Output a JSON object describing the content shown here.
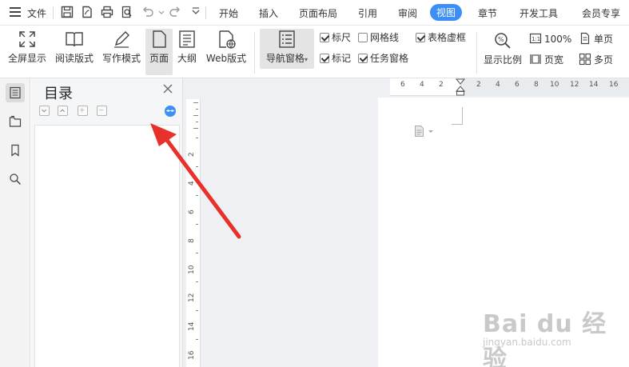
{
  "menubar": {
    "file_label": "文件",
    "quick_access_icons": [
      "save-icon",
      "export-pdf-icon",
      "print-icon",
      "print-preview-icon",
      "undo-icon",
      "redo-icon",
      "customize-icon"
    ],
    "tabs": [
      {
        "label": "开始",
        "active": false
      },
      {
        "label": "插入",
        "active": false
      },
      {
        "label": "页面布局",
        "active": false
      },
      {
        "label": "引用",
        "active": false
      },
      {
        "label": "审阅",
        "active": false
      },
      {
        "label": "视图",
        "active": true
      },
      {
        "label": "章节",
        "active": false
      },
      {
        "label": "开发工具",
        "active": false
      },
      {
        "label": "会员专享",
        "active": false
      }
    ]
  },
  "ribbon": {
    "fullscreen": "全屏显示",
    "read_mode": "阅读版式",
    "write_mode": "写作模式",
    "page": "页面",
    "outline": "大纲",
    "web": "Web版式",
    "nav_pane": "导航窗格",
    "ruler": "标尺",
    "gridlines": "网格线",
    "table_gridlines": "表格虚框",
    "markup": "标记",
    "task_pane": "任务窗格",
    "zoom": "显示比例",
    "zoom_100": "100%",
    "page_width": "页宽",
    "single_page": "单页",
    "multi_page": "多页",
    "checks": {
      "ruler": true,
      "gridlines": false,
      "table_gridlines": true,
      "markup": true,
      "task_pane": true
    }
  },
  "outline_pane": {
    "title": "目录"
  },
  "ruler": {
    "h_ticks": [
      "6",
      "4",
      "2",
      "2",
      "4",
      "6",
      "8",
      "10",
      "12",
      "14",
      "16"
    ],
    "v_ticks": [
      "2",
      "4",
      "6",
      "8",
      "10",
      "12",
      "14",
      "16"
    ]
  },
  "watermark": {
    "main": "Bai du 经验",
    "sub": "jingyan.baidu.com"
  },
  "colors": {
    "accent": "#3b8ff7",
    "arrow": "#e8312a"
  }
}
